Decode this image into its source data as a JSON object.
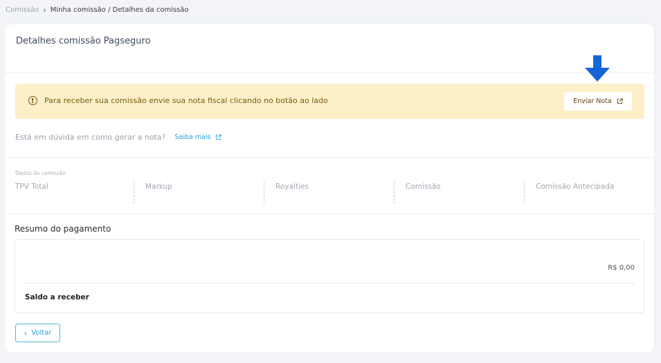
{
  "breadcrumb": {
    "root": "Comissão",
    "current": "Minha comissão / Detalhes da comissão"
  },
  "page": {
    "title": "Detalhes comissão Pagseguro"
  },
  "alert": {
    "message": "Para receber sua comissão envie sua nota fiscal clicando no botão ao lado",
    "button_label": "Enviar Nota",
    "icon": "info-circle-icon"
  },
  "help": {
    "question": "Está em dúvida em como gerar a nota?",
    "link_label": "Saiba mais"
  },
  "metrics": {
    "caption": "Dados da comissão",
    "items": [
      {
        "label": "TPV Total"
      },
      {
        "label": "Markup"
      },
      {
        "label": "Royalties"
      },
      {
        "label": "Comissão"
      },
      {
        "label": "Comissão Antecipada"
      }
    ]
  },
  "summary": {
    "title": "Resumo do pagamento",
    "amount": "R$ 0,00",
    "balance_label": "Saldo a receber"
  },
  "back_button": {
    "label": "Voltar"
  },
  "colors": {
    "alert_bg": "#fdf0c8",
    "alert_text": "#7a5a14",
    "link": "#2a9fd6",
    "arrow": "#1565d8"
  }
}
